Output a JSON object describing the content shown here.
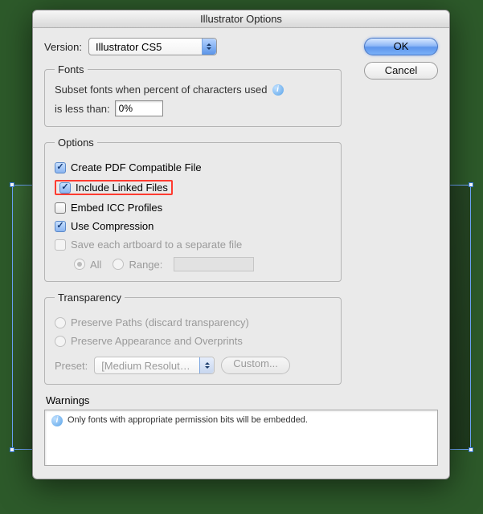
{
  "dialog": {
    "title": "Illustrator Options",
    "buttons": {
      "ok": "OK",
      "cancel": "Cancel"
    },
    "version": {
      "label": "Version:",
      "value": "Illustrator CS5"
    },
    "fonts": {
      "legend": "Fonts",
      "line1": "Subset fonts when percent of characters used",
      "line2_label": "is less than:",
      "value": "0%"
    },
    "options": {
      "legend": "Options",
      "create_pdf": {
        "label": "Create PDF Compatible File",
        "checked": true
      },
      "include_linked": {
        "label": "Include Linked Files",
        "checked": true,
        "highlighted": true
      },
      "embed_icc": {
        "label": "Embed ICC Profiles",
        "checked": false
      },
      "use_compression": {
        "label": "Use Compression",
        "checked": true
      },
      "save_each_artboard": {
        "label": "Save each artboard to a separate file",
        "checked": false,
        "disabled": true
      },
      "artboard_all": {
        "label": "All",
        "selected": true
      },
      "artboard_range": {
        "label": "Range:",
        "value": ""
      }
    },
    "transparency": {
      "legend": "Transparency",
      "preserve_paths": {
        "label": "Preserve Paths (discard transparency)"
      },
      "preserve_appearance": {
        "label": "Preserve Appearance and Overprints"
      },
      "preset_label": "Preset:",
      "preset_value": "[Medium Resolut…",
      "custom_label": "Custom..."
    },
    "warnings": {
      "label": "Warnings",
      "text": "Only fonts with appropriate permission bits will be embedded."
    }
  }
}
